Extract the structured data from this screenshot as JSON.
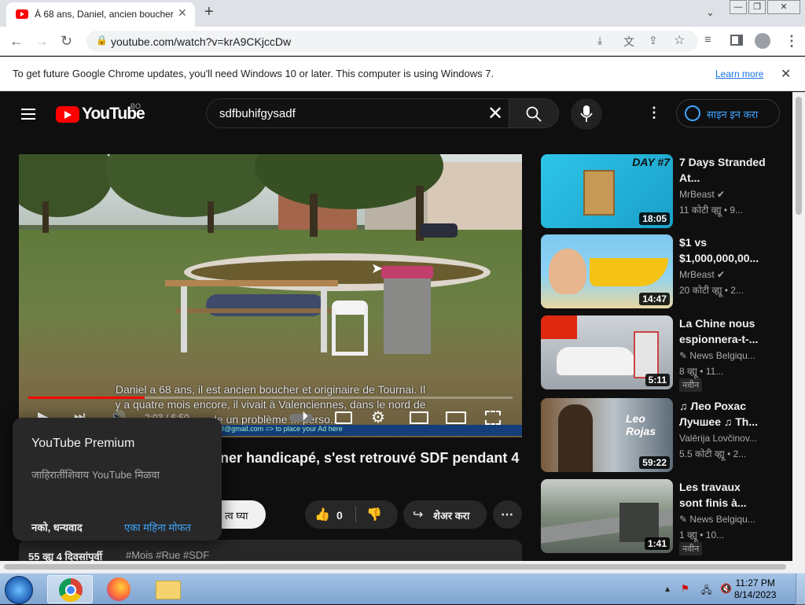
{
  "browser": {
    "tab_title": "À 68 ans, Daniel, ancien boucher",
    "tab_close": "✕",
    "new_tab": "+",
    "window_controls": [
      "—",
      "❐",
      "✕"
    ],
    "url": "youtube.com/watch?v=krA9CKjccDw",
    "infobar_message": "To get future Google Chrome updates, you'll need Windows 10 or later. This computer is using Windows 7.",
    "infobar_link": "Learn more",
    "infobar_close": "✕"
  },
  "youtube": {
    "logo_text": "YouTube",
    "country_code": "BO",
    "search_query": "sdfbuhifgysadf",
    "signin_label": "साइन इन करा"
  },
  "video": {
    "subtitle_line1": "Daniel a 68 ans, il est ancien boucher et originaire de Tournai. Il",
    "subtitle_line2": "y a quatre mois encore, il vivait à Valenciennes, dans le nord de",
    "subtitle_line3": "...de un problème ... perso...",
    "banner_text": "9@gmail.com => to place your Ad here",
    "progress_fraction": 0.24,
    "time_display": "2:03 / 6:50"
  },
  "below_video": {
    "title": "ner handicapé, s'est retrouvé SDF pendant 4",
    "subscribe_label": "त्व घ्या",
    "like_count": "0",
    "share_label": "शेअर करा",
    "views_meta": "55 व्ह्यू  4 दिवसांपूर्वी",
    "hashtags": "#Mois #Rue #SDF"
  },
  "premium_popup": {
    "title": "YouTube Premium",
    "description": "जाहिरातींशिवाय YouTube मिळवा",
    "decline": "नको, धन्यवाद",
    "try_label": "एका महिना मोफत"
  },
  "recommendations": [
    {
      "title": "7 Days Stranded At...",
      "channel": "MrBeast",
      "verified": true,
      "views": "11 कोटी व्ह्यू • 9...",
      "duration": "18:05",
      "badge": "",
      "thumb_label": "DAY #7"
    },
    {
      "title": "$1 vs $1,000,000,00...",
      "channel": "MrBeast",
      "verified": true,
      "views": "20 कोटी व्ह्यू • 2...",
      "duration": "14:47",
      "badge": "",
      "thumb_label": ""
    },
    {
      "title": "La Chine nous espionnera-t-...",
      "channel": "News Belgiqu...",
      "verified": false,
      "views": "8 व्ह्यू • 11...",
      "duration": "5:11",
      "badge": "नवीन",
      "thumb_label": ""
    },
    {
      "title": "♫ Лео Рохас Лучшее ♫ Th...",
      "channel": "Valērija Lovčinov...",
      "verified": false,
      "views": "5.5 कोटी व्ह्यू • 2...",
      "duration": "59:22",
      "badge": "",
      "thumb_label": "Leo Rojas"
    },
    {
      "title": "Les travaux sont finis à...",
      "channel": "News Belgiqu...",
      "verified": false,
      "views": "1 व्ह्यू • 10...",
      "duration": "1:41",
      "badge": "नवीन",
      "thumb_label": ""
    }
  ],
  "taskbar": {
    "time": "11:27 PM",
    "date": "8/14/2023"
  },
  "colors": {
    "youtube_red": "#ff0000",
    "link_blue": "#3ea6ff",
    "chrome_blue": "#1a73e8"
  }
}
